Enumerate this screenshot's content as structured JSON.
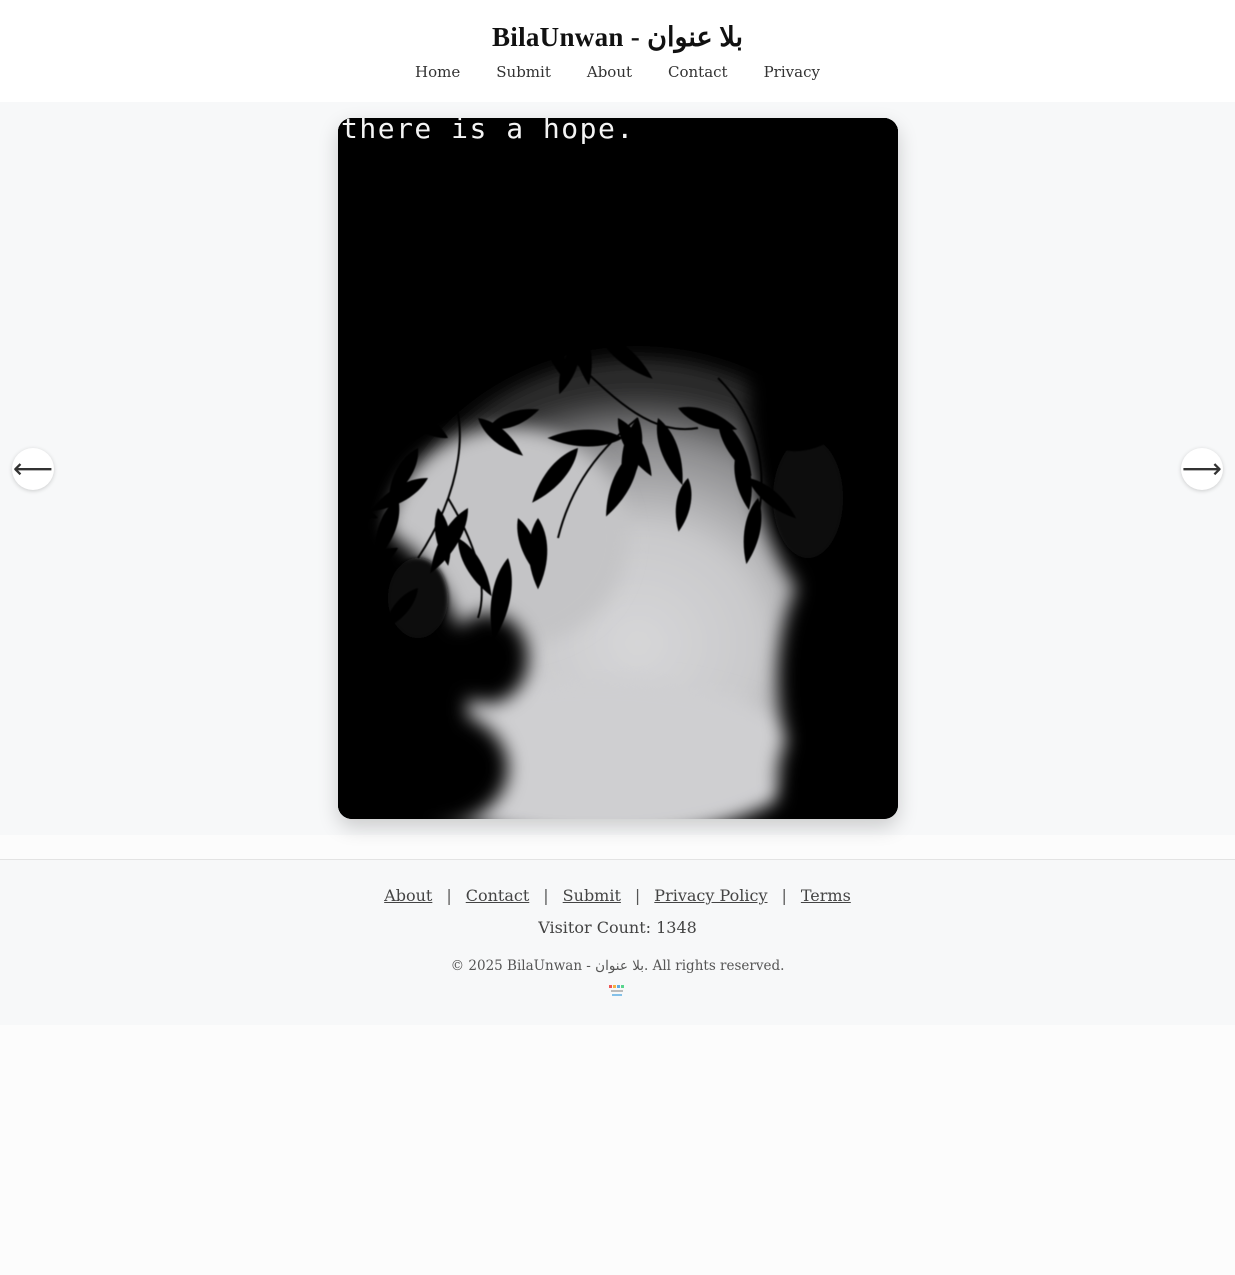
{
  "header": {
    "title": "BilaUnwan - بلا عنوان",
    "nav": [
      "Home",
      "Submit",
      "About",
      "Contact",
      "Privacy"
    ]
  },
  "slider": {
    "caption": "there is a hope.",
    "prev_label": "⟵",
    "next_label": "⟶"
  },
  "footer": {
    "links": [
      "About",
      "Contact",
      "Submit",
      "Privacy Policy",
      "Terms"
    ],
    "separator": "|",
    "visitor_label": "Visitor Count: 1348",
    "copyright": "© 2025 BilaUnwan - بلا عنوان. All rights reserved."
  },
  "colors": {
    "page_background": "#f7f8f9",
    "header_background": "#ffffff",
    "text": "#333333"
  }
}
